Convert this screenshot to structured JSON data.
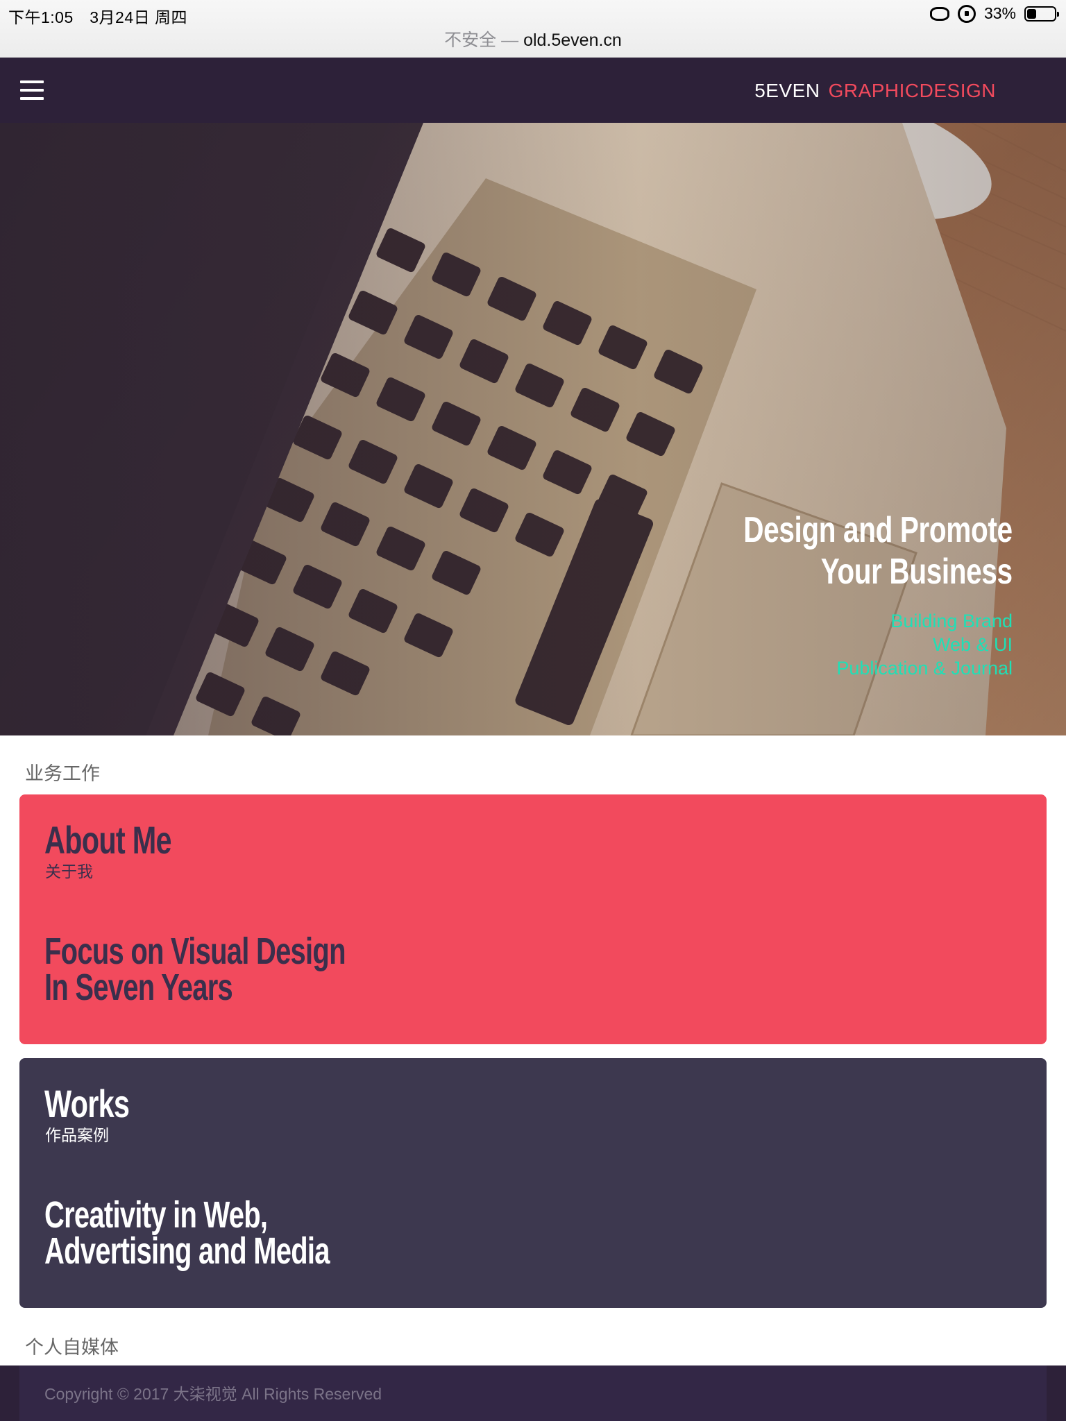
{
  "status_bar": {
    "time": "下午1:05　3月24日 周四",
    "battery": "33%",
    "battery_level": 0.33
  },
  "address_bar": {
    "insecure_label": "不安全",
    "separator": "—",
    "domain": "old.5even.cn"
  },
  "nav": {
    "brand_part1": "5EVEN",
    "brand_part2": "GRAPHICDESIGN",
    "brand_accent_color": "#f24a5d",
    "background_color": "#2d2139"
  },
  "hero": {
    "title_line1": "Design and Promote",
    "title_line2": "Your Business",
    "lines": [
      "Building Brand",
      "Web & UI",
      "Publication & Journal"
    ],
    "accent_color": "#1fe0b6"
  },
  "sections": {
    "business_heading": "业务工作",
    "media_heading": "个人自媒体"
  },
  "cards": [
    {
      "title": "About Me",
      "subtitle": "关于我",
      "tagline_line1": "Focus on Visual Design",
      "tagline_line2": "In Seven Years",
      "color": "#f24a5d"
    },
    {
      "title": "Works",
      "subtitle": "作品案例",
      "tagline_line1": "Creativity in Web,",
      "tagline_line2": "Advertising and Media",
      "color": "#3d384f"
    }
  ],
  "footer": {
    "copyright": "Copyright © 2017 大柒视觉 All Rights Reserved"
  }
}
